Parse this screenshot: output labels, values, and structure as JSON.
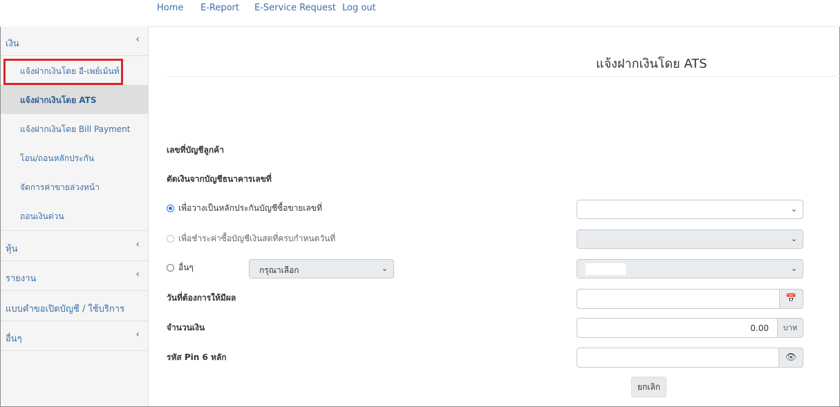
{
  "nav": {
    "items": [
      "Home",
      "E-Report",
      "E-Service Request",
      "Log out"
    ]
  },
  "sidebar": {
    "group_money": "เงิน",
    "sub_items": [
      "แจ้งฝากเงินโดย อี-เพย์เม้นท์",
      "แจ้งฝากเงินโดย ATS",
      "แจ้งฝากเงินโดย Bill Payment",
      "โอน/ถอนหลักประกัน",
      "จัดการค่าขายล่วงหน้า",
      "ถอนเงินด่วน"
    ],
    "group_stock": "หุ้น",
    "group_report": "รายงาน",
    "group_forms": "แบบคำขอเปิดบัญชี / ใช้บริการ",
    "group_other": "อื่นๆ",
    "chevron": "‹"
  },
  "main": {
    "title": "แจ้งฝากเงินโดย ATS",
    "customer_account_label": "เลขที่บัญชีลูกค้า",
    "debit_bank_label": "ตัดเงินจากบัญชีธนาคารเลขที่",
    "radio_collateral_label": "เพื่อวางเป็นหลักประกันบัญชีซื้อขายเลขที่",
    "radio_cash_label": "เพื่อชำระค่าซื้อบัญชีเงินสดที่ครบกำหนดวันที่",
    "radio_other_label": "อื่นๆ",
    "other_select_value": "กรุณาเลือก",
    "effective_date_label": "วันที่ต้องการให้มีผล",
    "amount_label": "จำนวนเงิน",
    "amount_value": "0.00",
    "amount_unit": "บาท",
    "pin_label": "รหัส Pin 6 หลัก",
    "cancel_button": "ยกเลิก",
    "caret": "⌄",
    "calendar_icon": "📅",
    "eye_icon": "👁"
  },
  "colors": {
    "accent": "#3b6fa8",
    "highlight": "#d9252a"
  }
}
